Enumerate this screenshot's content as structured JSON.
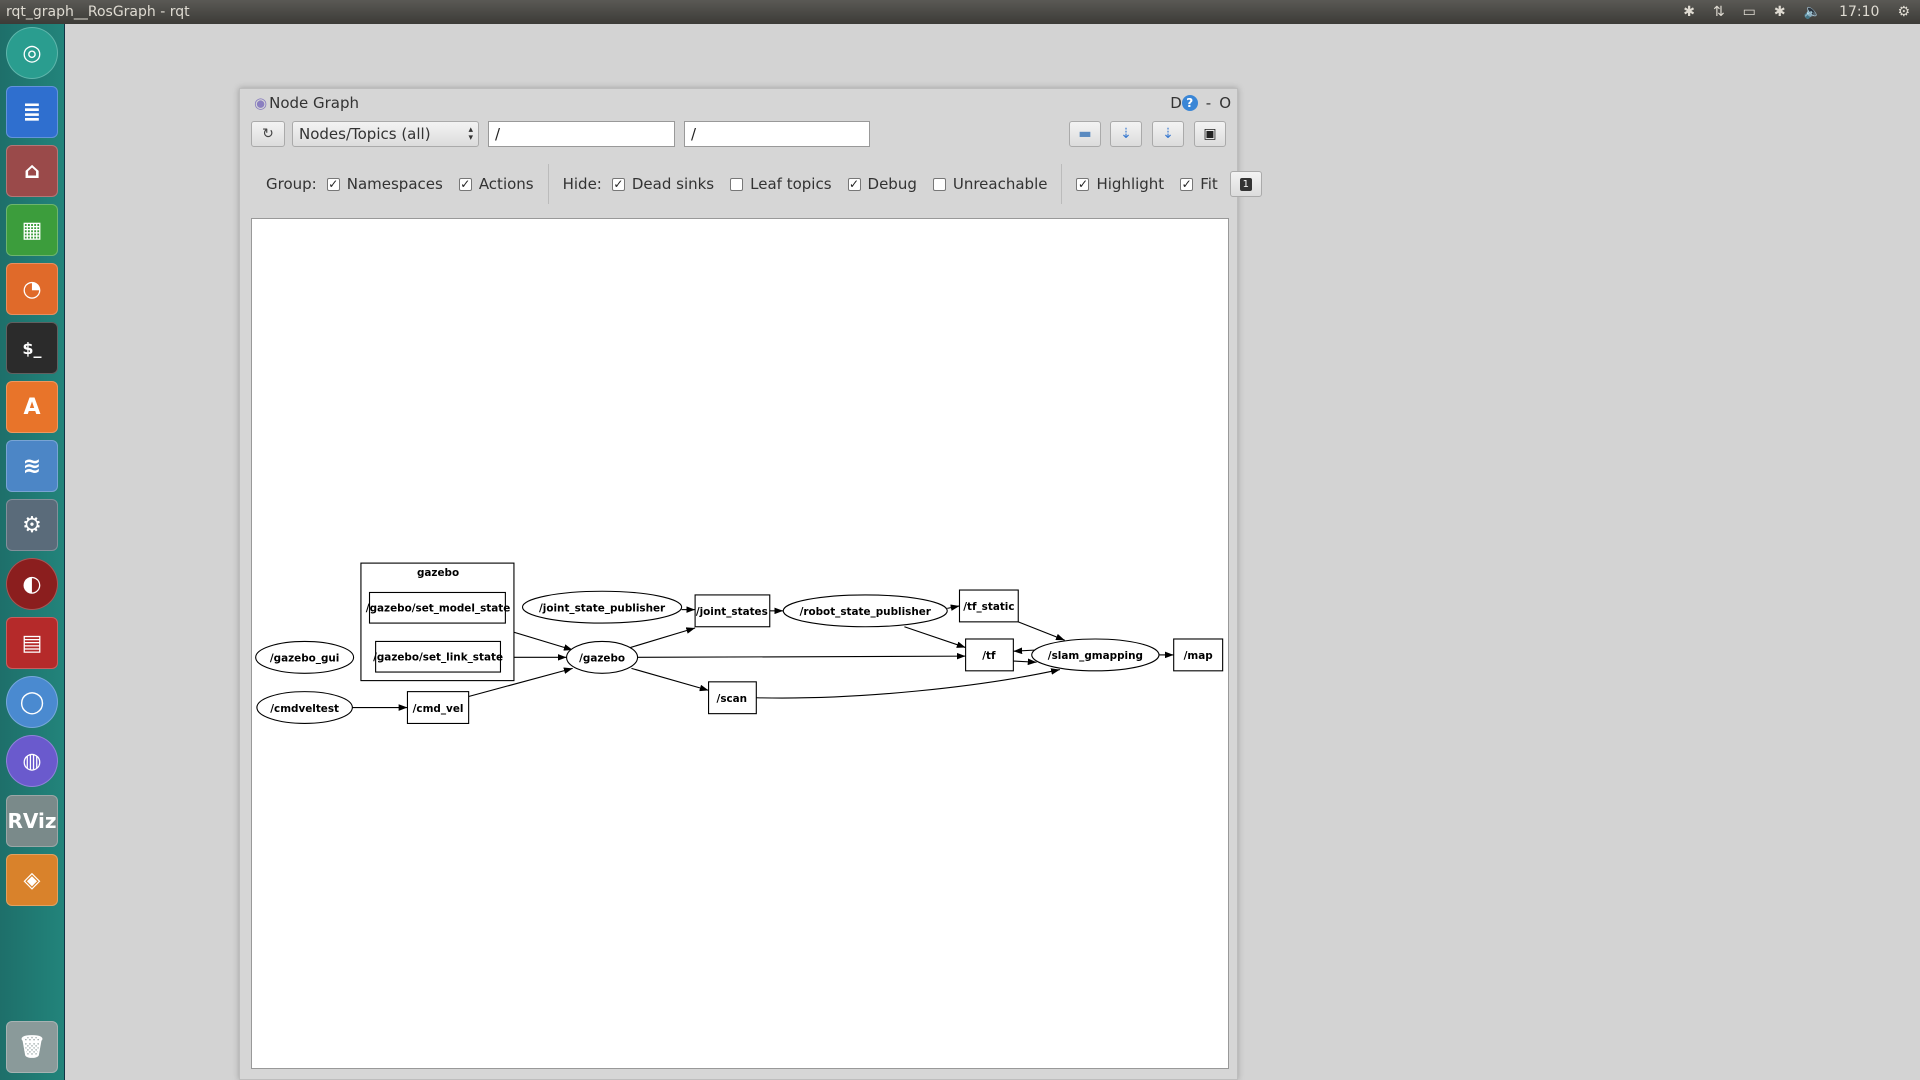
{
  "topbar": {
    "title": "rqt_graph__RosGraph - rqt",
    "time": "17:10"
  },
  "launcher": {
    "items": [
      "dash-icon",
      "writer-icon",
      "files-icon",
      "calc-icon",
      "impress-icon",
      "terminal-icon",
      "software-center-icon",
      "network-folder-icon",
      "settings-icon",
      "app-icon",
      "app-icon-2",
      "chromium-icon",
      "browser-icon",
      "rviz-icon",
      "gazebo-icon",
      "trash-icon"
    ],
    "rviz_label": "RViz"
  },
  "window": {
    "title": "Node Graph",
    "ctrl_d": "D",
    "ctrl_help": "?",
    "ctrl_min": "-",
    "ctrl_close": "O"
  },
  "toolbar": {
    "mode": "Nodes/Topics (all)",
    "filter1": "/",
    "filter2": "/"
  },
  "options": {
    "group_label": "Group:",
    "namespaces": "Namespaces",
    "namespaces_checked": true,
    "actions": "Actions",
    "actions_checked": true,
    "hide_label": "Hide:",
    "dead_sinks": "Dead sinks",
    "dead_sinks_checked": true,
    "leaf_topics": "Leaf topics",
    "leaf_topics_checked": false,
    "debug": "Debug",
    "debug_checked": true,
    "unreachable": "Unreachable",
    "unreachable_checked": false,
    "highlight": "Highlight",
    "highlight_checked": true,
    "fit": "Fit",
    "fit_checked": true,
    "one_label": "1"
  },
  "graph": {
    "cluster": "gazebo",
    "nodes": {
      "gazebo_gui": "/gazebo_gui",
      "cmdveltest": "/cmdveltest",
      "joint_state_publisher": "/joint_state_publisher",
      "gazebo": "/gazebo",
      "robot_state_publisher": "/robot_state_publisher",
      "slam_gmapping": "/slam_gmapping"
    },
    "topics": {
      "set_model_state": "/gazebo/set_model_state",
      "set_link_state": "/gazebo/set_link_state",
      "cmd_vel": "/cmd_vel",
      "joint_states": "/joint_states",
      "scan": "/scan",
      "tf_static": "/tf_static",
      "tf": "/tf",
      "map": "/map"
    }
  }
}
